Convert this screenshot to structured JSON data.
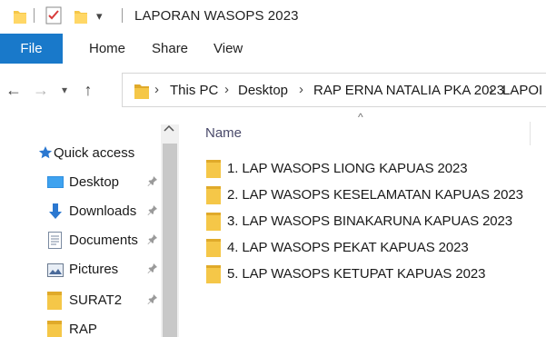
{
  "window": {
    "title": "LAPORAN WASOPS 2023",
    "quick_access_dropdown": "▾"
  },
  "ribbon": {
    "file": "File",
    "home": "Home",
    "share": "Share",
    "view": "View"
  },
  "nav": {
    "back": "←",
    "forward": "→",
    "recent": "▾",
    "up": "↑"
  },
  "breadcrumb": {
    "items": [
      "This PC",
      "Desktop",
      "RAP ERNA NATALIA PKA 2023",
      "LAPOI"
    ],
    "separator": "›"
  },
  "sidebar": {
    "items": [
      {
        "label": "Quick access",
        "icon": "star-icon"
      },
      {
        "label": "Desktop",
        "icon": "desktop-icon",
        "pinned": true
      },
      {
        "label": "Downloads",
        "icon": "download-icon",
        "pinned": true
      },
      {
        "label": "Documents",
        "icon": "document-icon",
        "pinned": true
      },
      {
        "label": "Pictures",
        "icon": "picture-icon",
        "pinned": true
      },
      {
        "label": "SURAT2",
        "icon": "folder-icon",
        "pinned": true
      },
      {
        "label": "RAP",
        "icon": "folder-icon",
        "pinned": false
      }
    ],
    "pin_glyph": "📌"
  },
  "content": {
    "column_header": "Name",
    "sort_indicator": "^",
    "files": [
      "1. LAP WASOPS LIONG KAPUAS 2023",
      "2. LAP WASOPS KESELAMATAN KAPUAS 2023",
      "3. LAP WASOPS BINAKARUNA KAPUAS 2023",
      "4. LAP WASOPS PEKAT KAPUAS 2023",
      "5. LAP WASOPS KETUPAT KAPUAS 2023"
    ]
  },
  "colors": {
    "accent": "#1979ca",
    "folder": "#f5c748",
    "folder_dark": "#e0aa2a",
    "star": "#2b78d0"
  }
}
